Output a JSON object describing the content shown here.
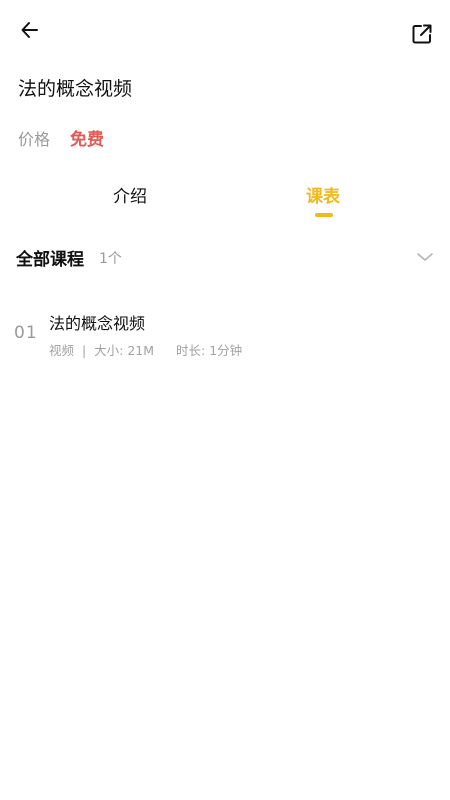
{
  "header": {
    "back_icon": "arrow-left-icon",
    "share_icon": "external-share-icon"
  },
  "course": {
    "title": "法的概念视频",
    "price_label": "价格",
    "price_value": "免费"
  },
  "tabs": [
    {
      "label": "介绍",
      "active": false
    },
    {
      "label": "课表",
      "active": true
    }
  ],
  "colors": {
    "accent": "#f2b81d",
    "price": "#e05b57",
    "muted": "#9a9a9a"
  },
  "syllabus": {
    "section_title": "全部课程",
    "count": "1个",
    "lessons": [
      {
        "index": "01",
        "title": "法的概念视频",
        "type": "视频",
        "size": "大小: 21M",
        "duration": "时长: 1分钟"
      }
    ]
  }
}
